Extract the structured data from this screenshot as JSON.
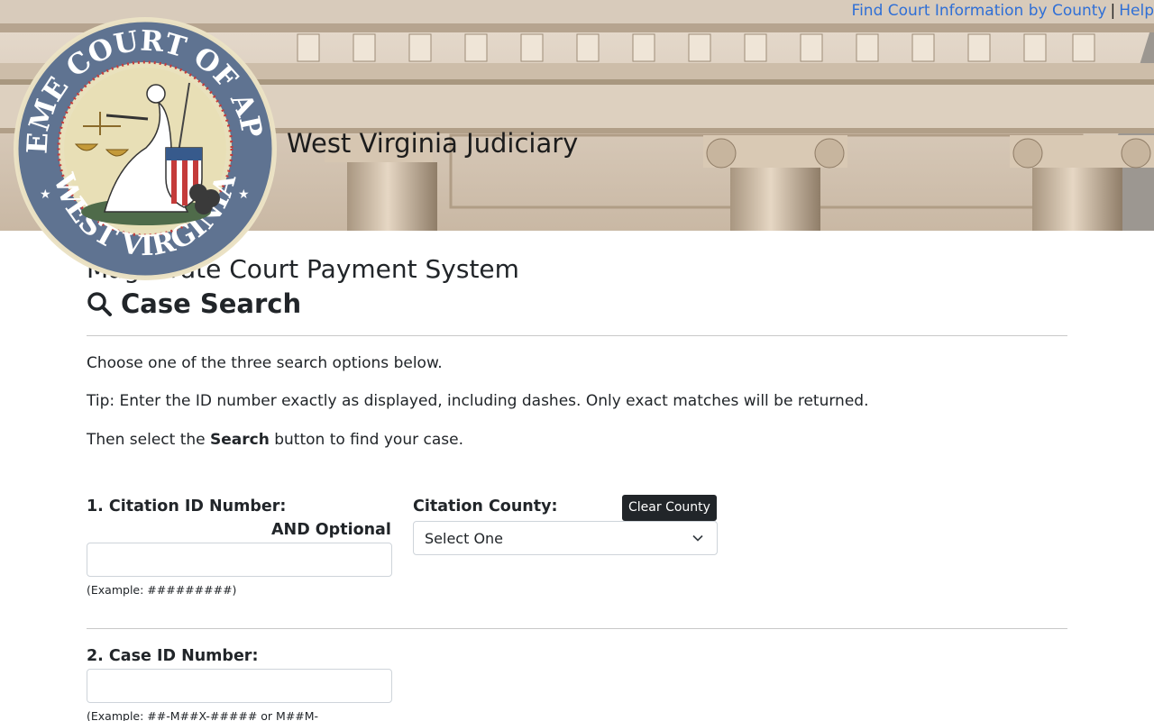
{
  "header": {
    "site_title": "West Virginia Judiciary",
    "links": [
      {
        "label": "Find Court Information by County"
      },
      {
        "label": "Help"
      }
    ],
    "link_separator": "|",
    "seal": {
      "top_text": "SUPREME COURT OF APPEALS",
      "bottom_text": "WEST VIRGINIA"
    },
    "link_color": "#2f6fd6"
  },
  "page": {
    "system_title": "Magistrate Court Payment System",
    "heading": "Case Search",
    "heading_icon": "search-icon",
    "instructions": [
      "Choose one of the three search options below.",
      "Tip: Enter the ID number exactly as displayed, including dashes. Only exact matches will be returned."
    ],
    "instruction_3_prefix": "Then select the ",
    "instruction_3_bold": "Search",
    "instruction_3_suffix": " button to find your case."
  },
  "form": {
    "citation": {
      "label": "1. Citation ID Number:",
      "and_optional": "AND Optional",
      "value": "",
      "hint": "(Example: #########)"
    },
    "county": {
      "label": "Citation County:",
      "selected": "Select One",
      "clear_label": "Clear County"
    },
    "case": {
      "label": "2. Case ID Number:",
      "value": "",
      "hint": "(Example: ##-M##X-##### or M##M-"
    }
  }
}
